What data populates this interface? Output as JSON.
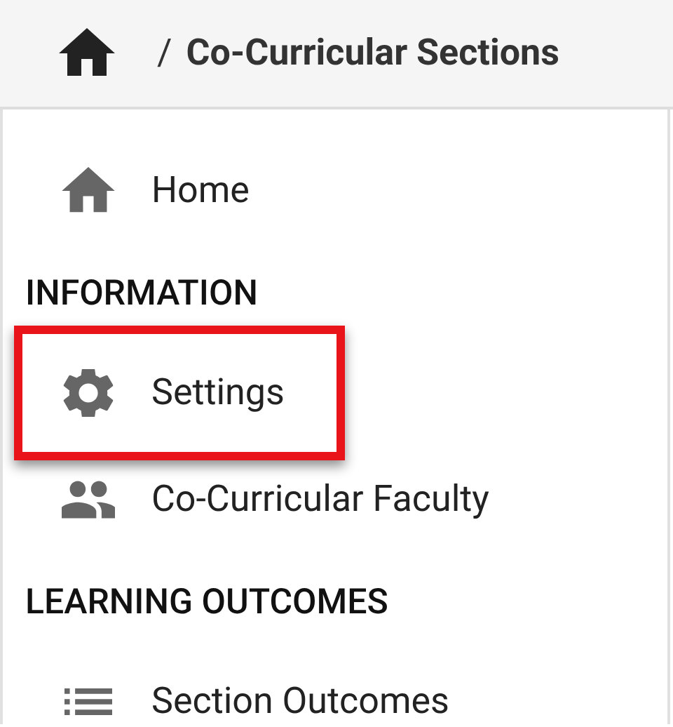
{
  "breadcrumb": {
    "separator": "/",
    "title": "Co-Curricular Sections"
  },
  "sidebar": {
    "items": [
      {
        "kind": "link",
        "label": "Home",
        "highlighted": false
      },
      {
        "kind": "heading",
        "label": "INFORMATION"
      },
      {
        "kind": "link",
        "label": "Settings",
        "highlighted": true
      },
      {
        "kind": "link",
        "label": "Co-Curricular Faculty",
        "highlighted": false
      },
      {
        "kind": "heading",
        "label": "LEARNING OUTCOMES"
      },
      {
        "kind": "link",
        "label": "Section Outcomes",
        "highlighted": false
      }
    ]
  }
}
